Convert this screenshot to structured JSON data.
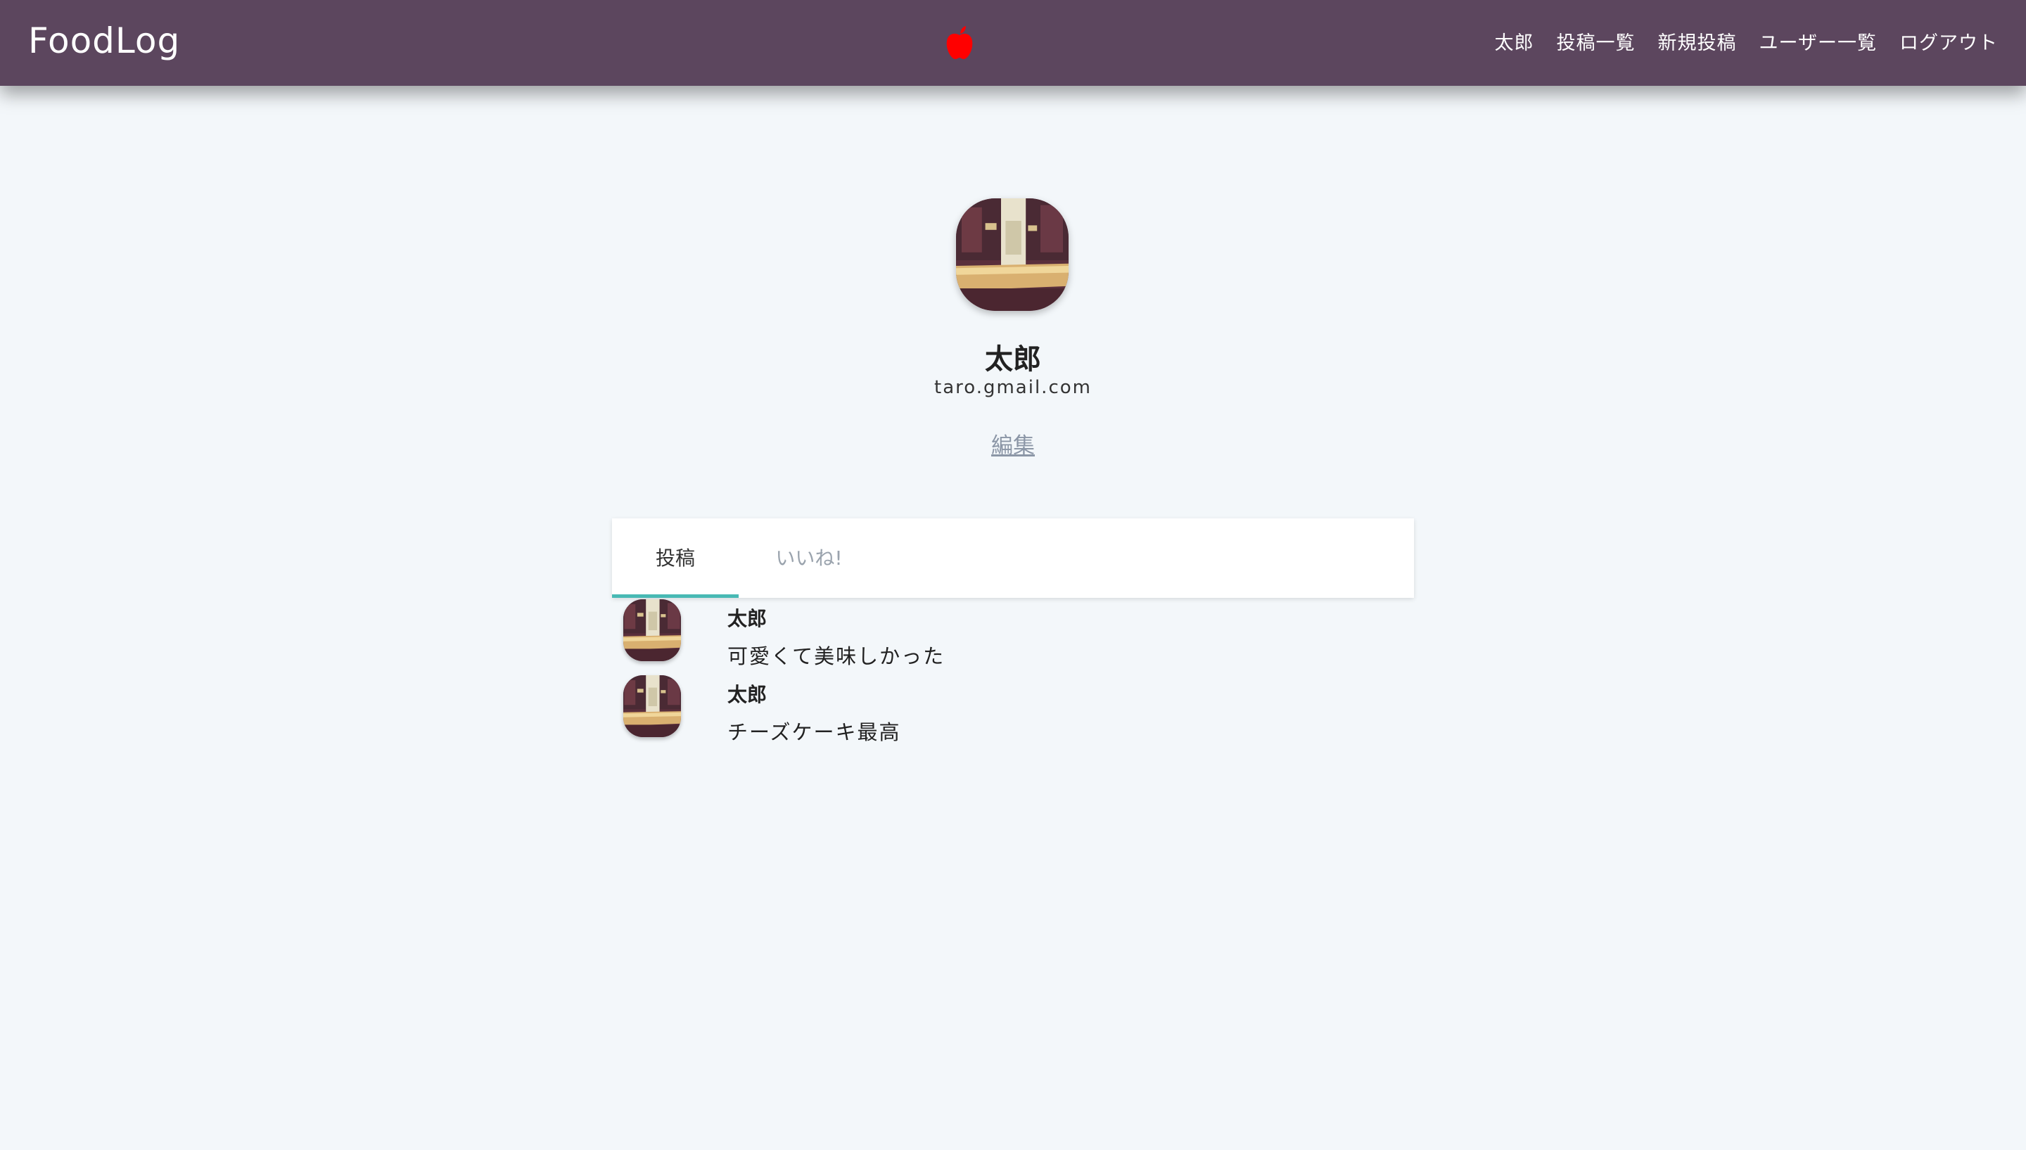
{
  "app": {
    "title": "FoodLog",
    "logo_icon": "apple-icon",
    "logo_color": "#ff0000"
  },
  "nav": {
    "links": [
      "太郎",
      "投稿一覧",
      "新規投稿",
      "ユーザー一覧",
      "ログアウト"
    ]
  },
  "profile": {
    "name": "太郎",
    "email": "taro.gmail.com",
    "edit_label": "編集"
  },
  "tabs": [
    {
      "label": "投稿",
      "active": true
    },
    {
      "label": "いいね!",
      "active": false
    }
  ],
  "posts": [
    {
      "author": "太郎",
      "body": "可愛くて美味しかった"
    },
    {
      "author": "太郎",
      "body": "チーズケーキ最高"
    }
  ],
  "colors": {
    "navbar": "#5c465e",
    "background": "#f3f7fa",
    "tab_indicator": "#48b9b4",
    "edit_link": "#8b96a6"
  }
}
